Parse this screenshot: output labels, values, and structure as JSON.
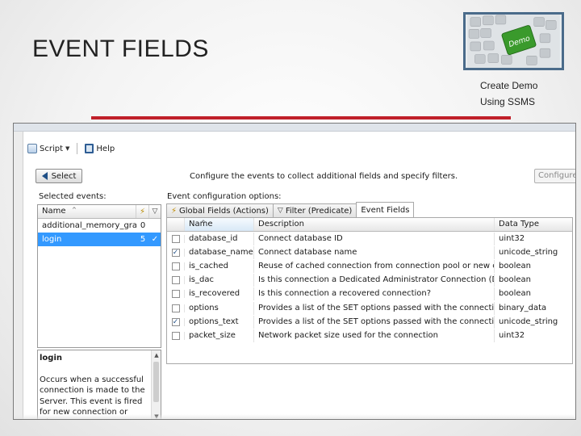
{
  "slide": {
    "title": "EVENT FIELDS",
    "notes": [
      "Create Demo",
      "Using SSMS"
    ],
    "colors": {
      "accent_rule": "#c0202a",
      "demo_key": "#3a9a2c",
      "selection": "#3399ff"
    },
    "demo_image": {
      "key_label": "Demo"
    }
  },
  "toolbar": {
    "script_label": "Script",
    "help_label": "Help"
  },
  "actions": {
    "select_label": "Select",
    "instructions": "Configure the events to collect additional fields and specify filters.",
    "configure_label": "Configure"
  },
  "selected_events": {
    "label": "Selected events:",
    "column_name": "Name",
    "rows": [
      {
        "name": "additional_memory_grant",
        "count": "0",
        "check": ""
      },
      {
        "name": "login",
        "count": "5",
        "check": "✓"
      }
    ]
  },
  "description": {
    "title": "login",
    "text": "Occurs when a successful connection is made to the Server. This event is fired for new connection or when"
  },
  "config": {
    "label": "Event configuration options:",
    "tabs": [
      "Global Fields (Actions)",
      "Filter (Predicate)",
      "Event Fields"
    ],
    "columns": [
      "Name",
      "Description",
      "Data Type"
    ],
    "rows": [
      {
        "checked": false,
        "name": "database_id",
        "description": "Connect database ID",
        "type": "uint32"
      },
      {
        "checked": true,
        "name": "database_name",
        "description": "Connect database name",
        "type": "unicode_string"
      },
      {
        "checked": false,
        "name": "is_cached",
        "description": "Reuse of cached connection from connection pool or new connec...",
        "type": "boolean"
      },
      {
        "checked": false,
        "name": "is_dac",
        "description": "Is this connection a Dedicated Administrator Connection (DAC)?",
        "type": "boolean"
      },
      {
        "checked": false,
        "name": "is_recovered",
        "description": "Is this connection a recovered connection?",
        "type": "boolean"
      },
      {
        "checked": false,
        "name": "options",
        "description": "Provides a list of the SET options passed with the connection",
        "type": "binary_data"
      },
      {
        "checked": true,
        "name": "options_text",
        "description": "Provides a list of the SET options passed with the connection",
        "type": "unicode_string"
      },
      {
        "checked": false,
        "name": "packet_size",
        "description": "Network packet size used for the connection",
        "type": "uint32"
      }
    ]
  }
}
